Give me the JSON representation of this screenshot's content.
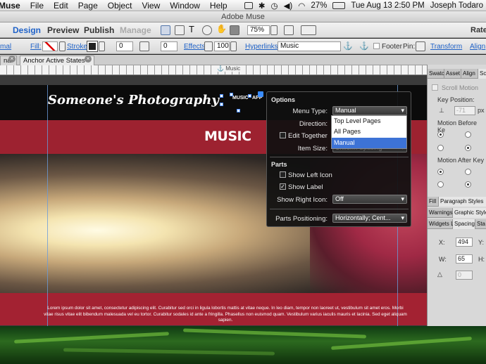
{
  "menubar": {
    "app": "Muse",
    "items": [
      "File",
      "Edit",
      "Page",
      "Object",
      "View",
      "Window",
      "Help"
    ],
    "battery": "27%",
    "datetime": "Tue Aug 13  2:50 PM",
    "user": "Joseph Todaro"
  },
  "window_title": "Adobe Muse",
  "workspace": {
    "tabs": [
      "Design",
      "Preview",
      "Publish",
      "Manage"
    ],
    "zoom": "75%",
    "right_label": "Rate"
  },
  "controlbar": {
    "mal": "mal",
    "fill_label": "Fill:",
    "stroke_label": "Stroke:",
    "stroke_width": "0",
    "corner_radius": "0",
    "effects_label": "Effects:",
    "opacity": "100",
    "hyperlinks_label": "Hyperlinks:",
    "hyperlink_value": "Music",
    "footer_label": "Footer",
    "pin_label": "Pin:",
    "transform_label": "Transform",
    "align_label": "Align"
  },
  "doc_tabs": [
    "nal",
    "Anchor Active States"
  ],
  "ruler_tag": "Music",
  "canvas": {
    "site_title": "Someone's Photography",
    "heading": "MUSIC",
    "menu_items": [
      "MUSIC",
      "APP"
    ],
    "lorem": "Lorem ipsum dolor sit amet, consectetur adipiscing elit. Curabitur sed orci in ligula lobortis mattis at vitae neque. In leo diam, tempor non laoreet ut, vestibulum sit amet eros. Morbi vitae risus vitae elit bibendum malesuada vel eu tortor. Curabitur sodales id ante a fringilla. Phasellus non euismod quam. Vestibulum varius iaculis mauris et lacinia. Sed eget aliquam sapien."
  },
  "options_panel": {
    "title": "Options",
    "menu_type_label": "Menu Type:",
    "menu_type_value": "Manual",
    "direction_label": "Direction:",
    "edit_together_label": "Edit Together",
    "item_size_label": "Item Size:",
    "item_size_value": "Uniform Spacing",
    "parts_title": "Parts",
    "show_left_icon": "Show Left Icon",
    "show_label": "Show Label",
    "show_right_icon_label": "Show Right Icon:",
    "show_right_icon_value": "Off",
    "parts_positioning_label": "Parts Positioning:",
    "parts_positioning_value": "Horizontally; Cent...",
    "dropdown_options": [
      "Top Level Pages",
      "All Pages",
      "Manual"
    ]
  },
  "right_panel": {
    "tabs1": [
      "Swatc",
      "Asset",
      "Align",
      "Scr"
    ],
    "scroll_motion": "Scroll Motion",
    "key_position_label": "Key Position:",
    "key_position_value": "-71",
    "key_unit": "px",
    "motion_before": "Motion Before Ke",
    "motion_after": "Motion After Key",
    "tabs2": [
      "Fill",
      "Paragraph Styles"
    ],
    "tabs3": [
      "Warnings",
      "Graphic Style"
    ],
    "tabs4": [
      "Widgets Li",
      "Spacing",
      "Sta"
    ],
    "x_label": "X:",
    "x_value": "494",
    "y_label": "Y:",
    "w_label": "W:",
    "w_value": "65",
    "h_label": "H:",
    "angle_value": "0"
  }
}
